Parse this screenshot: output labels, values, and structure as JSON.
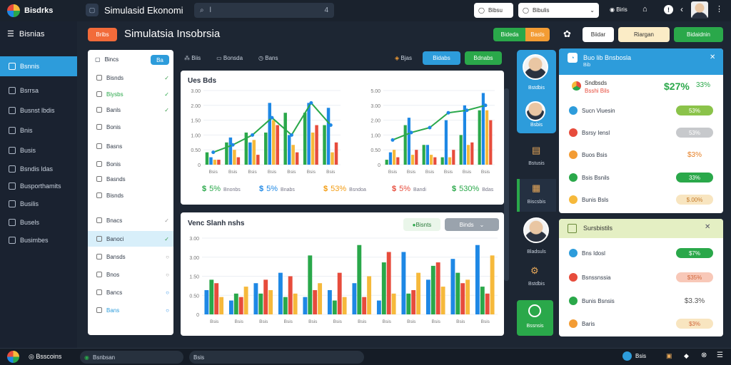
{
  "window": {
    "app_name": "Bisdrks",
    "title": "Simulasid Ekonomi"
  },
  "topbar": {
    "search_value": "l",
    "search_shortcut": "4",
    "dropdown_1": "Bibsu",
    "dropdown_2": "Bibulis",
    "user_label": "Biris"
  },
  "sidebar": {
    "header": "Bisnias",
    "items": [
      {
        "label": "Bsnnis",
        "active": true
      },
      {
        "label": "Bsrrsa"
      },
      {
        "label": "Busnst lbdis"
      },
      {
        "label": "Bnis"
      },
      {
        "label": "Busis"
      },
      {
        "label": "Bsndis ldas"
      },
      {
        "label": "Busporthamits"
      },
      {
        "label": "Busilis"
      },
      {
        "label": "Busels"
      },
      {
        "label": "Busimbes"
      }
    ]
  },
  "header": {
    "badge": "Bribs",
    "title": "Simulatsia Insobrsia",
    "btn_green": "Bideda",
    "btn_orange": "Basls",
    "btn_white": "Biidar",
    "btn_cream": "Riargan",
    "btn_green2": "Bidaidnin"
  },
  "list_panel": {
    "top_label": "Bincs",
    "top_button": "Ba",
    "rows": [
      {
        "label": "Bisnds",
        "mark": "✓",
        "color": "#3a9a4a"
      },
      {
        "label": "Biysbs",
        "mark": "✓",
        "color": "#2aa84a"
      },
      {
        "label": "Banls",
        "mark": "✓",
        "color": "#3a9a4a"
      },
      {
        "label": "Bonis",
        "mark": "",
        "color": ""
      },
      {
        "label": "Basns",
        "mark": "",
        "color": ""
      },
      {
        "label": "Bonis",
        "mark": "",
        "color": ""
      },
      {
        "label": "Basnds",
        "mark": "",
        "color": ""
      },
      {
        "label": "Bisnds",
        "mark": "",
        "color": ""
      },
      {
        "label": "Bnacs",
        "mark": "✓",
        "color": "#999"
      },
      {
        "label": "Banoci",
        "mark": "✓",
        "color": "#3a9a4a"
      },
      {
        "label": "Bansds",
        "mark": "○",
        "color": "#999"
      },
      {
        "label": "Bnos",
        "mark": "○",
        "color": "#999"
      },
      {
        "label": "Bancs",
        "mark": "○",
        "color": "#1e88e5"
      },
      {
        "label": "Bans",
        "mark": "○",
        "color": "#1e88e5"
      }
    ]
  },
  "toolbar": {
    "items": [
      "Biis",
      "Bonsda",
      "Bans"
    ],
    "right_label": "Bjas",
    "btn_blue": "Bidabs",
    "btn_green": "Bdnabs"
  },
  "chart_panel_1": {
    "title": "Ues Bds",
    "stats": [
      {
        "icon": "$",
        "value": "5%",
        "sub": "Bnonbs",
        "color": "#2aa84a"
      },
      {
        "icon": "$",
        "value": "5%",
        "sub": "Bnabs",
        "color": "#1e88e5"
      },
      {
        "icon": "$",
        "value": "53%",
        "sub": "Bsndoa",
        "color": "#f39c12"
      },
      {
        "icon": "$",
        "value": "5%",
        "sub": "Bandi",
        "color": "#e74c3c"
      },
      {
        "icon": "$",
        "value": "530%",
        "sub": "Bdas",
        "color": "#2aa84a"
      }
    ]
  },
  "chart_panel_2": {
    "title": "Venc Slanh nshs",
    "btn_1": "Bisnts",
    "btn_2": "Binds"
  },
  "mid_column": {
    "labels": [
      "Bstdbis",
      "Bsbis",
      "Bstusis",
      "Biscsbis",
      "Bladsuls",
      "Bstdbis",
      "Bssnsis"
    ]
  },
  "right_panel_1": {
    "title": "Buo lib Bnsbosla",
    "subtitle": "Bib",
    "top_label": "Sndbsds",
    "top_sub": "Bsshi Bils",
    "top_value": "$27%",
    "top_percent": "33%",
    "rows": [
      {
        "label": "Sucn Viuesin",
        "value": "53%",
        "color": "#8bc34a"
      },
      {
        "label": "Bsrsy Iensl",
        "value": "53%",
        "color": "#c7c9cc"
      },
      {
        "label": "Buos Bsis",
        "value": "$3%",
        "color": ""
      },
      {
        "label": "Bsis Bsnils",
        "value": "33%",
        "color": "#2aa84a"
      },
      {
        "label": "Bunis Bsls",
        "value": "$.00%",
        "color": "#f8e5c0"
      }
    ]
  },
  "right_panel_2": {
    "title": "Sursbistils",
    "rows": [
      {
        "label": "Bns Idosl",
        "value": "$7%",
        "color": "#2aa84a"
      },
      {
        "label": "Bsnssnssia",
        "value": "$35%",
        "color": "#f8c8b8"
      },
      {
        "label": "Bunis Bsnsis",
        "value": "$3.3%",
        "color": ""
      },
      {
        "label": "Baris",
        "value": "$3%",
        "color": "#f8e5c0"
      }
    ]
  },
  "bottombar": {
    "brand": "Bsscoins",
    "field_1": "Bsnbsan",
    "field_2": "Bsis",
    "right_label": "Bsis"
  },
  "chart_data": [
    {
      "type": "bar",
      "categories": [
        "Bsis",
        "Bsis",
        "Bsis",
        "Bsis",
        "Bsis",
        "Bsis",
        "Bsis"
      ],
      "series": [
        {
          "values": [
            0.5,
            0.9,
            1.3,
            1.3,
            2.1,
            2.1,
            1.6
          ],
          "color": "#2aa84a"
        },
        {
          "values": [
            0.3,
            1.1,
            0.9,
            2.5,
            1.2,
            2.5,
            2.3
          ],
          "color": "#1e88e5"
        },
        {
          "values": [
            0.2,
            0.6,
            1.0,
            1.8,
            0.8,
            1.3,
            0.5
          ],
          "color": "#f6b93b"
        },
        {
          "values": [
            0.2,
            0.3,
            0.4,
            1.6,
            0.5,
            1.6,
            0.9
          ],
          "color": "#e74c3c"
        }
      ],
      "line": [
        0.5,
        0.8,
        1.2,
        1.9,
        1.2,
        2.5,
        1.6
      ],
      "yticks": [
        "0",
        "0.50",
        "1.00",
        "1.50",
        "2.00",
        "3.00"
      ],
      "ylim": [
        0,
        3
      ]
    },
    {
      "type": "bar",
      "categories": [
        "Bsis",
        "Bsis",
        "Bsis",
        "Bsis",
        "Bsis",
        "Bsis"
      ],
      "series": [
        {
          "values": [
            0.2,
            1.6,
            0.8,
            0.3,
            1.2,
            2.2
          ],
          "color": "#2aa84a"
        },
        {
          "values": [
            0.5,
            1.9,
            0.8,
            1.8,
            2.4,
            2.9
          ],
          "color": "#1e88e5"
        },
        {
          "values": [
            0.6,
            0.4,
            0.4,
            0.3,
            0.8,
            2.2
          ],
          "color": "#f6b93b"
        },
        {
          "values": [
            0.3,
            0.6,
            0.3,
            0.6,
            0.9,
            1.8
          ],
          "color": "#e74c3c"
        }
      ],
      "line": [
        1.0,
        1.3,
        1.5,
        2.1,
        2.2,
        2.4
      ],
      "yticks": [
        "0",
        "0.50",
        "1.00",
        "2.00",
        "3.00",
        "5.00"
      ],
      "ylim": [
        0,
        3
      ]
    },
    {
      "type": "bar",
      "categories": [
        "Bsis",
        "Bsis",
        "Bsis",
        "Bsis",
        "Bsis",
        "Bsis",
        "Bsis",
        "Bsis",
        "Bsis",
        "Bsis",
        "Bsis",
        "Bsis"
      ],
      "series": [
        {
          "values": [
            0.7,
            0.4,
            0.9,
            1.2,
            0.5,
            0.7,
            0.9,
            0.4,
            1.8,
            1.0,
            1.6,
            2.0
          ],
          "color": "#1e88e5"
        },
        {
          "values": [
            1.0,
            0.6,
            0.6,
            0.5,
            1.7,
            0.4,
            2.0,
            1.5,
            0.6,
            1.4,
            1.2,
            0.8
          ],
          "color": "#2aa84a"
        },
        {
          "values": [
            0.9,
            0.5,
            1.0,
            1.1,
            0.7,
            1.2,
            0.5,
            1.8,
            0.7,
            1.5,
            0.9,
            0.6
          ],
          "color": "#e74c3c"
        },
        {
          "values": [
            0.5,
            0.8,
            0.7,
            0.6,
            0.9,
            0.5,
            1.1,
            0.6,
            1.2,
            0.8,
            1.0,
            1.7
          ],
          "color": "#f6b93b"
        }
      ],
      "yticks": [
        "0",
        "0.50",
        "1.50",
        "3.00",
        "3.00"
      ],
      "ylim": [
        0,
        2.2
      ]
    }
  ]
}
